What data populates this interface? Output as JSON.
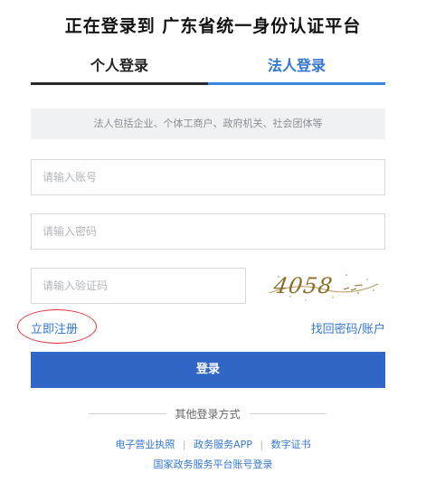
{
  "header": {
    "title": "正在登录到 广东省统一身份认证平台"
  },
  "tabs": [
    {
      "label": "个人登录",
      "active": false
    },
    {
      "label": "法人登录",
      "active": true
    }
  ],
  "notice": "法人包括企业、个体工商户、政府机关、社会团体等",
  "form": {
    "account_placeholder": "请输入账号",
    "password_placeholder": "请输入密码",
    "captcha_placeholder": "请输入验证码",
    "captcha_image_text": "4058"
  },
  "links": {
    "register": "立即注册",
    "forgot": "找回密码/账户"
  },
  "login_button": "登录",
  "other_login": {
    "title": "其他登录方式",
    "options": [
      "电子营业执照",
      "政务服务APP",
      "数字证书",
      "国家政务服务平台账号登录"
    ],
    "separator": "|"
  },
  "colors": {
    "accent": "#3476d2",
    "button": "#3067c6",
    "annotation_circle": "#e0383b"
  }
}
